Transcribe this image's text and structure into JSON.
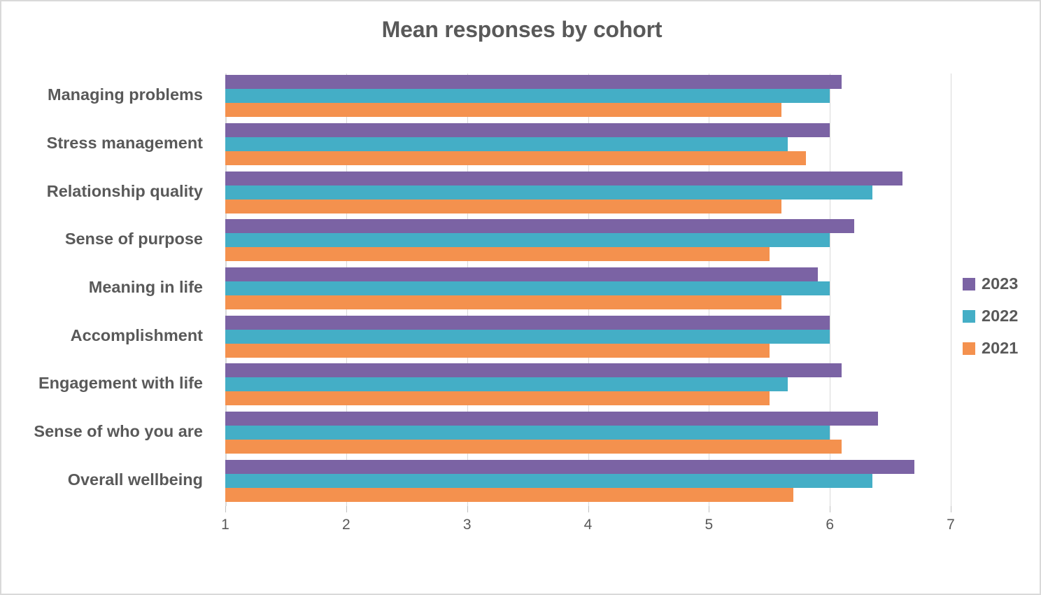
{
  "chart_data": {
    "type": "bar",
    "orientation": "horizontal",
    "title": "Mean responses by cohort",
    "xlabel": "",
    "ylabel": "",
    "xlim": [
      1,
      7
    ],
    "xticks": [
      1,
      2,
      3,
      4,
      5,
      6,
      7
    ],
    "grid": true,
    "legend_position": "right",
    "categories": [
      "Managing problems",
      "Stress management",
      "Relationship quality",
      "Sense of purpose",
      "Meaning in life",
      "Accomplishment",
      "Engagement with life",
      "Sense of who you are",
      "Overall wellbeing"
    ],
    "series": [
      {
        "name": "2023",
        "color": "#7B63A4",
        "values": [
          6.1,
          6.0,
          6.6,
          6.2,
          5.9,
          6.0,
          6.1,
          6.4,
          6.7
        ]
      },
      {
        "name": "2022",
        "color": "#44AEC6",
        "values": [
          6.0,
          5.65,
          6.35,
          6.0,
          6.0,
          6.0,
          5.65,
          6.0,
          6.35
        ]
      },
      {
        "name": "2021",
        "color": "#F4914E",
        "values": [
          5.6,
          5.8,
          5.6,
          5.5,
          5.6,
          5.5,
          5.5,
          6.1,
          5.7
        ]
      }
    ]
  },
  "colors": {
    "title_text": "#595959",
    "axis_text": "#595959",
    "gridline": "#d9d9d9",
    "frame_border": "#d9d9d9",
    "background": "#ffffff"
  }
}
